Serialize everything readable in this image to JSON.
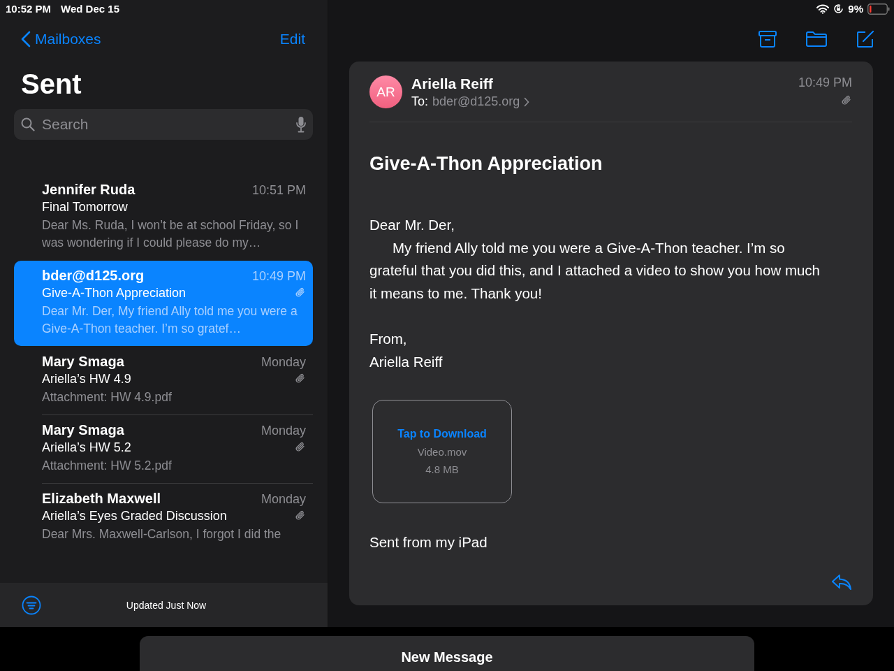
{
  "status_bar": {
    "time": "10:52 PM",
    "date": "Wed Dec 15",
    "battery": "9%"
  },
  "sidebar": {
    "back_label": "Mailboxes",
    "edit_label": "Edit",
    "title": "Sent",
    "search": {
      "placeholder": "Search"
    },
    "messages": [
      {
        "sender": "Jennifer Ruda",
        "time": "10:51 PM",
        "subject": "Final Tomorrow",
        "preview": "Dear Ms. Ruda, I won’t be at school Friday, so I was wondering if I could please do my…",
        "has_attachment": false,
        "selected": false
      },
      {
        "sender": "bder@d125.org",
        "time": "10:49 PM",
        "subject": "Give-A-Thon Appreciation",
        "preview": "Dear Mr. Der, My friend Ally told me you were a Give-A-Thon teacher. I’m so gratef…",
        "has_attachment": true,
        "selected": true
      },
      {
        "sender": "Mary Smaga",
        "time": "Monday",
        "subject": "Ariella’s HW 4.9",
        "preview": "Attachment: HW 4.9.pdf",
        "has_attachment": true,
        "selected": false
      },
      {
        "sender": "Mary Smaga",
        "time": "Monday",
        "subject": "Ariella’s HW 5.2",
        "preview": "Attachment: HW 5.2.pdf",
        "has_attachment": true,
        "selected": false
      },
      {
        "sender": "Elizabeth Maxwell",
        "time": "Monday",
        "subject": "Ariella’s Eyes Graded Discussion",
        "preview": "Dear Mrs. Maxwell-Carlson, I forgot I did the",
        "has_attachment": true,
        "selected": false
      }
    ],
    "toolbar": {
      "status": "Updated Just Now"
    }
  },
  "message": {
    "avatar_initials": "AR",
    "sender": "Ariella Reiff",
    "to_label": "To:",
    "to": "bder@d125.org",
    "time": "10:49 PM",
    "subject": "Give-A-Thon Appreciation",
    "greeting": "Dear Mr. Der,",
    "paragraph": "My friend Ally told me you were a Give-A-Thon teacher. I’m so grateful that you did this, and I attached a video to show you how much it means to me. Thank you!",
    "closing": "From,",
    "signature": "Ariella Reiff",
    "attachment_card": {
      "action": "Tap to Download",
      "filename": "Video.mov",
      "size": "4.8 MB"
    },
    "footer": "Sent from my iPad"
  },
  "new_message": {
    "title": "New Message"
  }
}
